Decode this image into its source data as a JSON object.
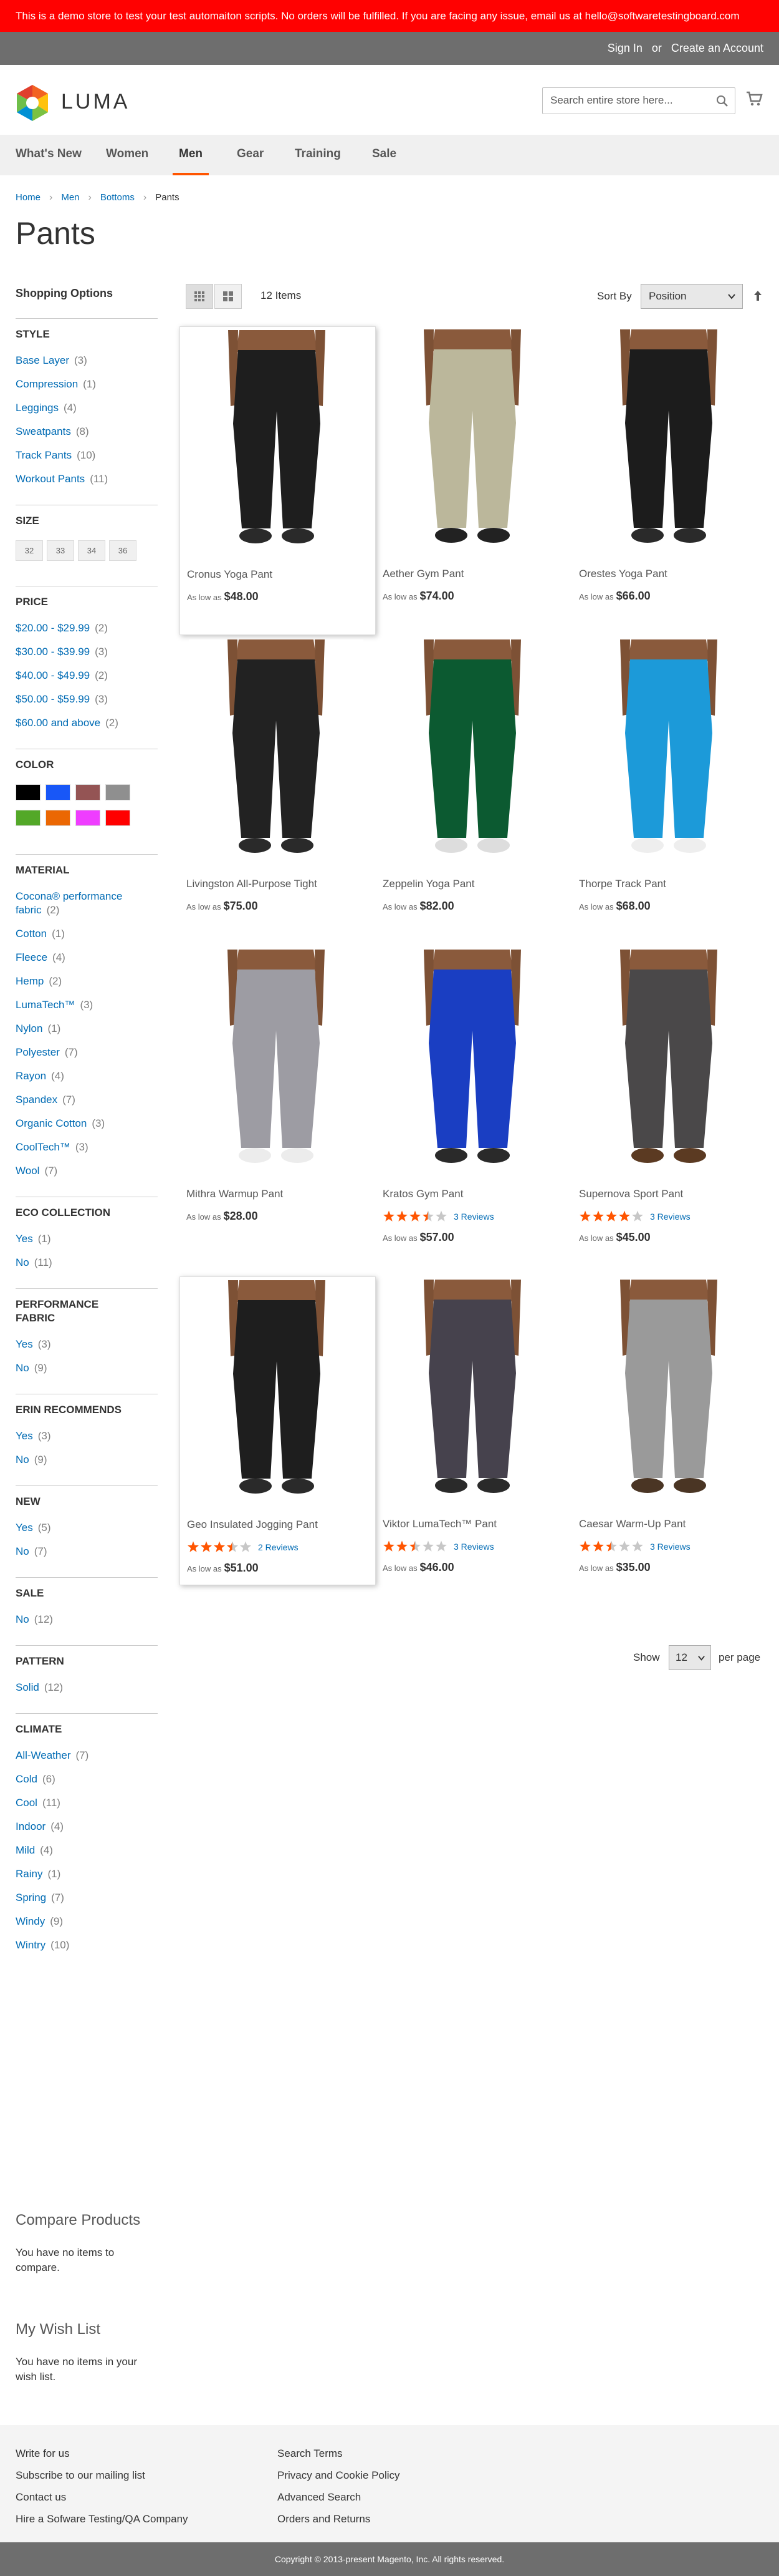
{
  "demo_banner": "This is a demo store to test your test automaiton scripts. No orders will be fulfilled. If you are facing any issue, email us at hello@softwaretestingboard.com",
  "topbar": {
    "sign_in": "Sign In",
    "or": "or",
    "create_account": "Create an Account"
  },
  "header": {
    "logo_text": "LUMA",
    "search_placeholder": "Search entire store here...",
    "brand_colors": {
      "orange": "#f26322",
      "yellow": "#ffc20e",
      "green": "#7ac143",
      "blue": "#0090d4"
    }
  },
  "nav": [
    "What's New",
    "Women",
    "Men",
    "Gear",
    "Training",
    "Sale"
  ],
  "nav_active": "Men",
  "accent_color": "#ff5501",
  "breadcrumb": {
    "home": "Home",
    "men": "Men",
    "bottoms": "Bottoms",
    "current": "Pants"
  },
  "page_title": "Pants",
  "sidebar": {
    "title": "Shopping Options",
    "style": {
      "title": "Style",
      "options": [
        {
          "label": "Base Layer",
          "count": "(3)"
        },
        {
          "label": "Compression",
          "count": "(1)"
        },
        {
          "label": "Leggings",
          "count": "(4)"
        },
        {
          "label": "Sweatpants",
          "count": "(8)"
        },
        {
          "label": "Track Pants",
          "count": "(10)"
        },
        {
          "label": "Workout Pants",
          "count": "(11)"
        }
      ]
    },
    "size": {
      "title": "Size",
      "options": [
        "32",
        "33",
        "34",
        "36"
      ]
    },
    "price": {
      "title": "Price",
      "options": [
        {
          "label": "$20.00 - $29.99",
          "count": "(2)"
        },
        {
          "label": "$30.00 - $39.99",
          "count": "(3)"
        },
        {
          "label": "$40.00 - $49.99",
          "count": "(2)"
        },
        {
          "label": "$50.00 - $59.99",
          "count": "(3)"
        },
        {
          "label": "$60.00 and above",
          "count": "(2)"
        }
      ]
    },
    "color": {
      "title": "Color",
      "swatches": [
        "#000000",
        "#1857f7",
        "#945454",
        "#8f8f8f",
        "#53a828",
        "#eb6703",
        "#ef3dff",
        "#ff0000"
      ]
    },
    "material": {
      "title": "Material",
      "options": [
        {
          "label": "Cocona® performance fabric",
          "count": "(2)"
        },
        {
          "label": "Cotton",
          "count": "(1)"
        },
        {
          "label": "Fleece",
          "count": "(4)"
        },
        {
          "label": "Hemp",
          "count": "(2)"
        },
        {
          "label": "LumaTech™",
          "count": "(3)"
        },
        {
          "label": "Nylon",
          "count": "(1)"
        },
        {
          "label": "Polyester",
          "count": "(7)"
        },
        {
          "label": "Rayon",
          "count": "(4)"
        },
        {
          "label": "Spandex",
          "count": "(7)"
        },
        {
          "label": "Organic Cotton",
          "count": "(3)"
        },
        {
          "label": "CoolTech™",
          "count": "(3)"
        },
        {
          "label": "Wool",
          "count": "(7)"
        }
      ]
    },
    "eco": {
      "title": "Eco Collection",
      "options": [
        {
          "label": "Yes",
          "count": "(1)"
        },
        {
          "label": "No",
          "count": "(11)"
        }
      ]
    },
    "performance": {
      "title": "Performance Fabric",
      "options": [
        {
          "label": "Yes",
          "count": "(3)"
        },
        {
          "label": "No",
          "count": "(9)"
        }
      ]
    },
    "erin": {
      "title": "Erin Recommends",
      "options": [
        {
          "label": "Yes",
          "count": "(3)"
        },
        {
          "label": "No",
          "count": "(9)"
        }
      ]
    },
    "new": {
      "title": "New",
      "options": [
        {
          "label": "Yes",
          "count": "(5)"
        },
        {
          "label": "No",
          "count": "(7)"
        }
      ]
    },
    "sale": {
      "title": "Sale",
      "options": [
        {
          "label": "No",
          "count": "(12)"
        }
      ]
    },
    "pattern": {
      "title": "Pattern",
      "options": [
        {
          "label": "Solid",
          "count": "(12)"
        }
      ]
    },
    "climate": {
      "title": "Climate",
      "options": [
        {
          "label": "All-Weather",
          "count": "(7)"
        },
        {
          "label": "Cold",
          "count": "(6)"
        },
        {
          "label": "Cool",
          "count": "(11)"
        },
        {
          "label": "Indoor",
          "count": "(4)"
        },
        {
          "label": "Mild",
          "count": "(4)"
        },
        {
          "label": "Rainy",
          "count": "(1)"
        },
        {
          "label": "Spring",
          "count": "(7)"
        },
        {
          "label": "Windy",
          "count": "(9)"
        },
        {
          "label": "Wintry",
          "count": "(10)"
        }
      ]
    }
  },
  "compare": {
    "title": "Compare Products",
    "text": "You have no items to compare."
  },
  "wishlist": {
    "title": "My Wish List",
    "text": "You have no items in your wish list."
  },
  "toolbar": {
    "count": "12 Items",
    "sort_label": "Sort By",
    "sort_value": "Position"
  },
  "products": [
    {
      "name": "Cronus Yoga Pant",
      "prefix": "As low as",
      "price": "$48.00",
      "pant_color": "#1e1e1e",
      "shoe": "#2a2a2a",
      "rating": null,
      "reviews": null
    },
    {
      "name": "Aether Gym Pant",
      "prefix": "As low as",
      "price": "$74.00",
      "pant_color": "#bbb79b",
      "shoe": "#222222",
      "rating": null,
      "reviews": null
    },
    {
      "name": "Orestes Yoga Pant",
      "prefix": "As low as",
      "price": "$66.00",
      "pant_color": "#1c1c1c",
      "shoe": "#2a2a2a",
      "rating": null,
      "reviews": null
    },
    {
      "name": "Livingston All-Purpose Tight",
      "prefix": "As low as",
      "price": "$75.00",
      "pant_color": "#222222",
      "shoe": "#2a2a2a",
      "rating": null,
      "reviews": null
    },
    {
      "name": "Zeppelin Yoga Pant",
      "prefix": "As low as",
      "price": "$82.00",
      "pant_color": "#0c5a31",
      "shoe": "#dddddd",
      "rating": null,
      "reviews": null
    },
    {
      "name": "Thorpe Track Pant",
      "prefix": "As low as",
      "price": "$68.00",
      "pant_color": "#1c9ad9",
      "shoe": "#eeeeee",
      "rating": null,
      "reviews": null
    },
    {
      "name": "Mithra Warmup Pant",
      "prefix": "As low as",
      "price": "$28.00",
      "pant_color": "#9d9ca3",
      "shoe": "#ececec",
      "rating": null,
      "reviews": null
    },
    {
      "name": "Kratos Gym Pant",
      "prefix": "As low as",
      "price": "$57.00",
      "pant_color": "#1a3ec2",
      "shoe": "#2a2a2a",
      "rating": 3.5,
      "reviews": "3 Reviews"
    },
    {
      "name": "Supernova Sport Pant",
      "prefix": "As low as",
      "price": "$45.00",
      "pant_color": "#4a4849",
      "shoe": "#5b3a22",
      "rating": 4,
      "reviews": "3 Reviews"
    },
    {
      "name": "Geo Insulated Jogging Pant",
      "prefix": "As low as",
      "price": "$51.00",
      "pant_color": "#1e1e1e",
      "shoe": "#2a2a2a",
      "rating": 3.5,
      "reviews": "2 Reviews"
    },
    {
      "name": "Viktor LumaTech™ Pant",
      "prefix": "As low as",
      "price": "$46.00",
      "pant_color": "#46424d",
      "shoe": "#2a2a2a",
      "rating": 2.5,
      "reviews": "3 Reviews"
    },
    {
      "name": "Caesar Warm-Up Pant",
      "prefix": "As low as",
      "price": "$35.00",
      "pant_color": "#9a9a9a",
      "shoe": "#4a3524",
      "rating": 2.5,
      "reviews": "3 Reviews"
    }
  ],
  "pager": {
    "show_label": "Show",
    "limit": "12",
    "per_page_label": "per page"
  },
  "footer": {
    "col1": [
      "Write for us",
      "Subscribe to our mailing list",
      "Contact us",
      "Hire a Sofware Testing/QA Company"
    ],
    "col2": [
      "Search Terms",
      "Privacy and Cookie Policy",
      "Advanced Search",
      "Orders and Returns"
    ],
    "copyright": "Copyright © 2013-present Magento, Inc. All rights reserved."
  }
}
